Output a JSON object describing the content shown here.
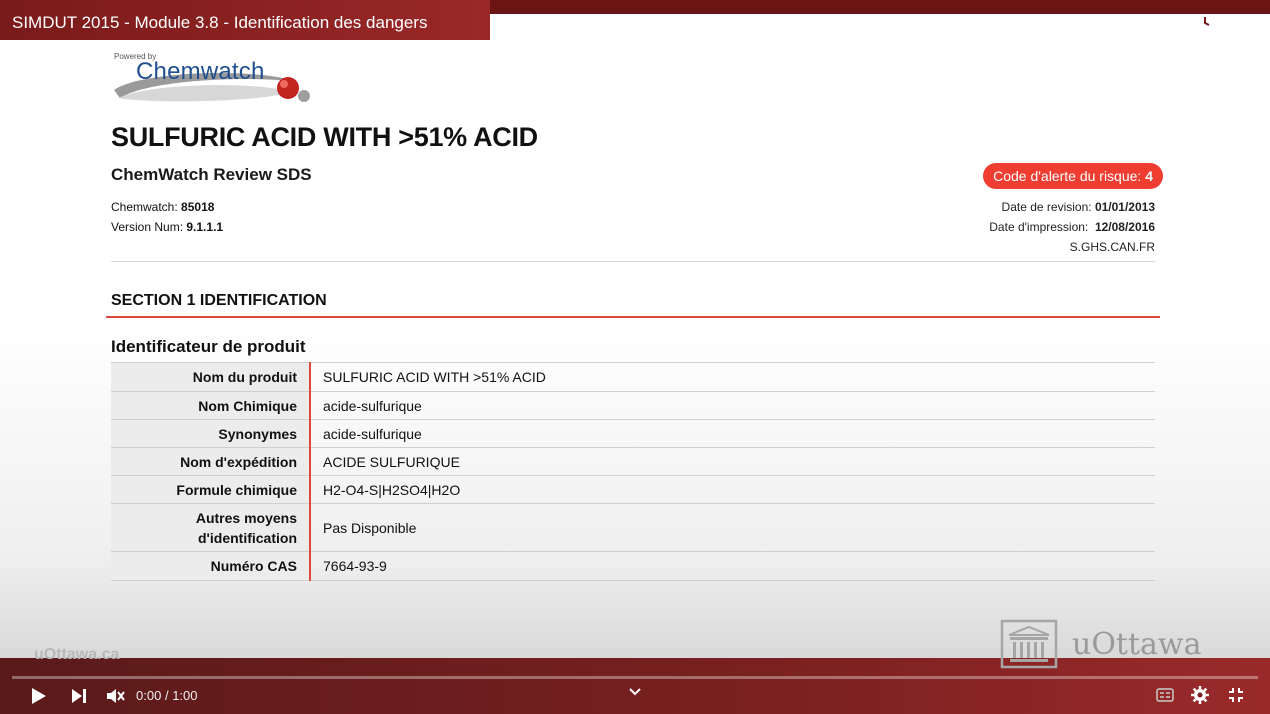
{
  "player": {
    "video_title": "SIMDUT 2015 - Module 3.8 - Identification des dangers",
    "time_current": "0:00",
    "time_separator": "/",
    "time_total": "1:00",
    "icons": [
      "watch-later-icon",
      "share-icon",
      "play-icon",
      "next-icon",
      "mute-icon",
      "chevron-down-icon",
      "captions-icon",
      "settings-icon",
      "exit-fullscreen-icon"
    ]
  },
  "logo": {
    "powered": "Powered by",
    "name": "Chemwatch"
  },
  "document": {
    "title": "SULFURIC ACID WITH >51% ACID",
    "subtitle": "ChemWatch Review SDS",
    "chemwatch_label": "Chemwatch:",
    "chemwatch_value": "85018",
    "version_label": "Version Num:",
    "version_value": "9.1.1.1",
    "alert_label": "Code d'alerte du risque:",
    "alert_value": "4",
    "revision_label": "Date de revision:",
    "revision_value": "01/01/2013",
    "print_label": "Date d'impression:",
    "print_value": "12/08/2016",
    "code": "S.GHS.CAN.FR",
    "section_title": "SECTION 1 IDENTIFICATION",
    "subsection_title": "Identificateur de produit",
    "rows": [
      {
        "label": "Nom du produit",
        "value": "SULFURIC ACID WITH >51% ACID"
      },
      {
        "label": "Nom Chimique",
        "value": "acide-sulfurique"
      },
      {
        "label": "Synonymes",
        "value": "acide-sulfurique"
      },
      {
        "label": "Nom d'expédition",
        "value": "ACIDE SULFURIQUE"
      },
      {
        "label": "Formule chimique",
        "value": "H2-O4-S|H2SO4|H2O"
      },
      {
        "label": "Autres moyens d'identification",
        "value": "Pas Disponible"
      },
      {
        "label": "Numéro CAS",
        "value": "7664-93-9"
      }
    ]
  },
  "branding": {
    "site": "uOttawa.ca",
    "wordmark": "uOttawa"
  },
  "colors": {
    "accent_red": "#e0463a",
    "badge_red": "#ef3d31",
    "title_bar": "#8a2222",
    "logo_blue": "#1f4f8f"
  }
}
